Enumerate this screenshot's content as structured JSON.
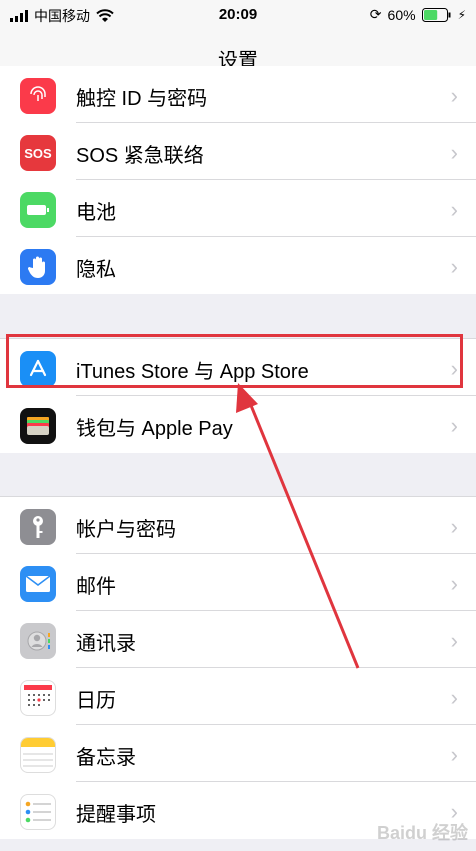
{
  "status_bar": {
    "carrier": "中国移动",
    "time": "20:09",
    "battery_percent": "60%",
    "battery_level": 0.6,
    "battery_color": "#4cd964"
  },
  "nav": {
    "title": "设置"
  },
  "group1": [
    {
      "label": "触控 ID 与密码",
      "icon": "fingerprint-icon",
      "color": "#fb3a4a"
    },
    {
      "label": "SOS 紧急联络",
      "icon": "sos-icon",
      "color": "#e6383d",
      "icon_text": "SOS"
    },
    {
      "label": "电池",
      "icon": "battery-icon",
      "color": "#4cd964"
    },
    {
      "label": "隐私",
      "icon": "hand-icon",
      "color": "#2c7af2"
    }
  ],
  "group2": [
    {
      "label": "iTunes Store 与 App Store",
      "icon": "app-store-icon",
      "color": "#1a8ff6"
    },
    {
      "label": "钱包与 Apple Pay",
      "icon": "wallet-icon",
      "color": "#111111"
    }
  ],
  "group3": [
    {
      "label": "帐户与密码",
      "icon": "key-icon",
      "color": "#8e8e93"
    },
    {
      "label": "邮件",
      "icon": "mail-icon",
      "color": "#2d8ff4"
    },
    {
      "label": "通讯录",
      "icon": "contacts-icon",
      "color": "#c9c9cc"
    },
    {
      "label": "日历",
      "icon": "calendar-icon",
      "color": "#ffffff"
    },
    {
      "label": "备忘录",
      "icon": "notes-icon",
      "color": "#ffffff"
    },
    {
      "label": "提醒事项",
      "icon": "reminders-icon",
      "color": "#ffffff"
    }
  ],
  "highlight_color": "#e0353e",
  "watermark": "Baidu 经验"
}
